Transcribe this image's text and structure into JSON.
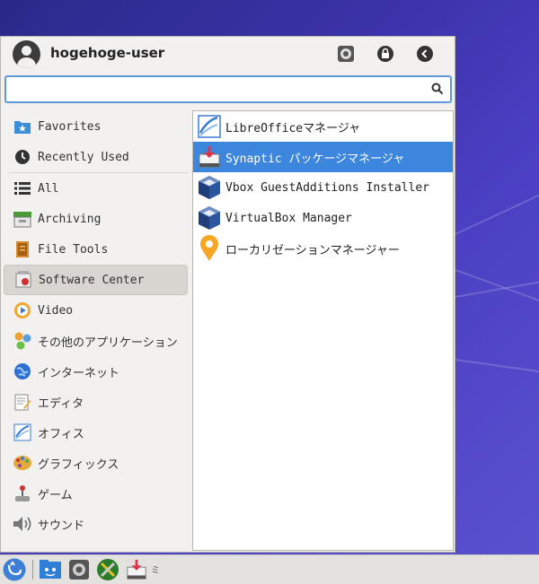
{
  "user": {
    "name": "hogehoge-user"
  },
  "search": {
    "value": "",
    "placeholder": ""
  },
  "categories": [
    {
      "label": "Favorites",
      "icon": "folder-star-icon"
    },
    {
      "label": "Recently Used",
      "icon": "clock-icon"
    },
    {
      "label": "All",
      "icon": "list-icon"
    },
    {
      "label": "Archiving",
      "icon": "archive-icon"
    },
    {
      "label": "File Tools",
      "icon": "file-tools-icon"
    },
    {
      "label": "Software Center",
      "icon": "software-center-icon",
      "selected": true
    },
    {
      "label": "Video",
      "icon": "video-icon"
    },
    {
      "label": "その他のアプリケーション",
      "icon": "other-apps-icon"
    },
    {
      "label": "インターネット",
      "icon": "internet-icon"
    },
    {
      "label": "エディタ",
      "icon": "editor-icon"
    },
    {
      "label": "オフィス",
      "icon": "office-icon"
    },
    {
      "label": "グラフィックス",
      "icon": "graphics-icon"
    },
    {
      "label": "ゲーム",
      "icon": "joystick-icon"
    },
    {
      "label": "サウンド",
      "icon": "speaker-icon"
    }
  ],
  "apps": [
    {
      "label": "LibreOfficeマネージャ",
      "icon": "libreoffice-icon"
    },
    {
      "label": "Synaptic パッケージマネージャ",
      "icon": "synaptic-icon",
      "selected": true
    },
    {
      "label": "Vbox GuestAdditions Installer",
      "icon": "virtualbox-icon"
    },
    {
      "label": "VirtualBox Manager",
      "icon": "virtualbox-icon"
    },
    {
      "label": "ローカリゼーションマネージャー",
      "icon": "location-pin-icon"
    }
  ],
  "taskbar": {
    "overflow_label": "ミ"
  },
  "colors": {
    "selection": "#3d86dd",
    "search_border": "#5f9ad8",
    "desktop": "#3b32a8"
  }
}
